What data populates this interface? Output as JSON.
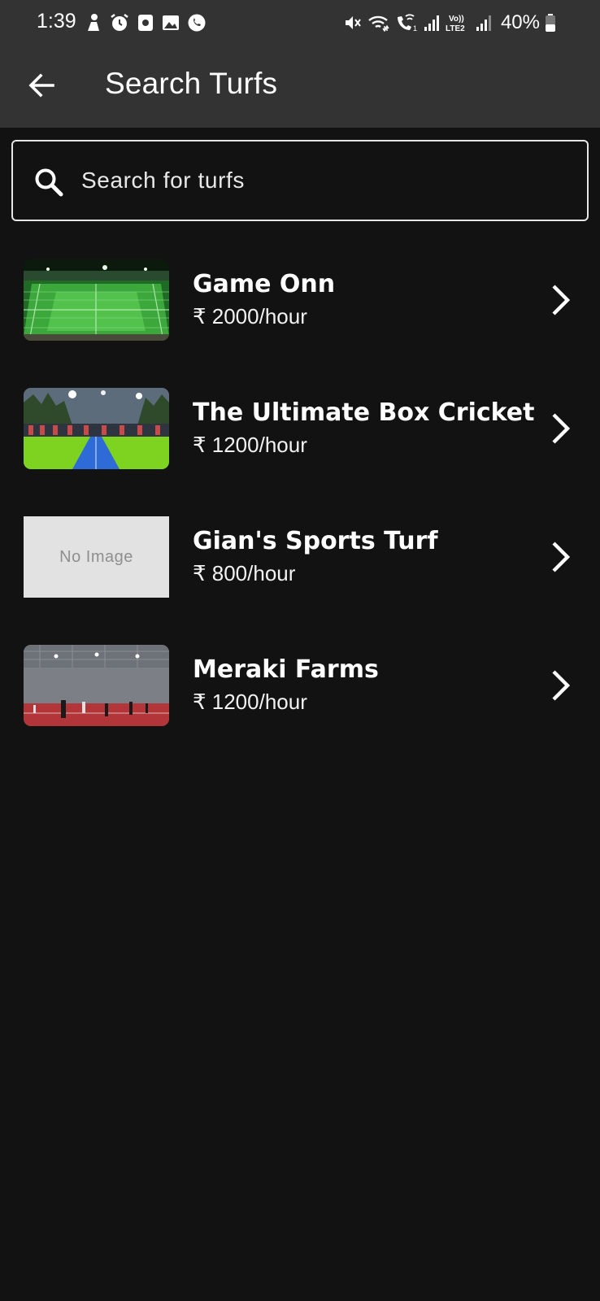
{
  "status_bar": {
    "time": "1:39",
    "battery": "40%",
    "left_icons": [
      "person-icon",
      "alarm-icon",
      "square-app-icon",
      "gallery-icon",
      "whatsapp-icon"
    ],
    "right_icons": [
      "mute-icon",
      "wifi-icon",
      "wifi-calling-icon",
      "signal-icon",
      "volte-icon",
      "signal-icon",
      "battery-icon"
    ]
  },
  "app_bar": {
    "title": "Search Turfs",
    "back_icon": "arrow-left-icon"
  },
  "search": {
    "placeholder": "Search for turfs",
    "value": "",
    "icon": "search-icon"
  },
  "turfs": [
    {
      "name": "Game Onn",
      "price": "₹ 2000/hour",
      "image": "lit-football-turf-photo",
      "no_image_text": ""
    },
    {
      "name": "The Ultimate Box Cricket",
      "price": "₹ 1200/hour",
      "image": "box-cricket-pitch-photo",
      "no_image_text": ""
    },
    {
      "name": "Gian's Sports Turf",
      "price": "₹ 800/hour",
      "image": "placeholder",
      "no_image_text": "No Image"
    },
    {
      "name": "Meraki Farms",
      "price": "₹ 1200/hour",
      "image": "indoor-court-photo",
      "no_image_text": ""
    }
  ],
  "colors": {
    "background": "#121212",
    "app_bar": "#333333",
    "text": "#ffffff",
    "search_border": "#e6e6e6",
    "placeholder_box": "#e2e2e2"
  }
}
